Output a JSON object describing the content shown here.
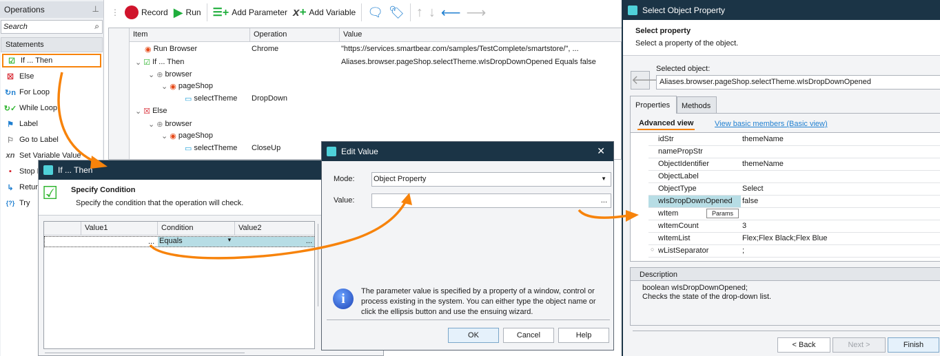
{
  "operations_panel": {
    "title": "Operations",
    "search_placeholder": "Search",
    "section": "Statements",
    "items": [
      "If ... Then",
      "Else",
      "For Loop",
      "While Loop",
      "Label",
      "Go to Label",
      "Set Variable Value",
      "Stop E",
      "Retur",
      "Try"
    ]
  },
  "toolbar": {
    "record": "Record",
    "run": "Run",
    "add_parameter": "Add Parameter",
    "add_variable": "Add Variable"
  },
  "test_grid": {
    "columns": [
      "Item",
      "Operation",
      "Value"
    ],
    "rows": [
      {
        "item": "Run Browser",
        "operation": "Chrome",
        "value": "\"https://services.smartbear.com/samples/TestComplete/smartstore/\", ..."
      },
      {
        "item": "If ... Then",
        "operation": "",
        "value": "Aliases.browser.pageShop.selectTheme.wIsDropDownOpened Equals false"
      },
      {
        "item": "browser",
        "operation": "",
        "value": ""
      },
      {
        "item": "pageShop",
        "operation": "",
        "value": ""
      },
      {
        "item": "selectTheme",
        "operation": "DropDown",
        "value": ""
      },
      {
        "item": "Else",
        "operation": "",
        "value": ""
      },
      {
        "item": "browser",
        "operation": "",
        "value": ""
      },
      {
        "item": "pageShop",
        "operation": "",
        "value": ""
      },
      {
        "item": "selectTheme",
        "operation": "CloseUp",
        "value": ""
      }
    ]
  },
  "if_dialog": {
    "title": "If ... Then",
    "heading": "Specify Condition",
    "subheading": "Specify the condition that the operation will check.",
    "columns": [
      "Value1",
      "Condition",
      "Value2"
    ],
    "condition_value": "Equals",
    "ellipsis": "..."
  },
  "edit_value_dialog": {
    "title": "Edit Value",
    "mode_label": "Mode:",
    "mode_value": "Object Property",
    "value_label": "Value:",
    "value_value": "",
    "ellipsis": "...",
    "info": "The parameter value is specified by a property of a window, control or process existing in the system. You can either type the object name or click the ellipsis button and use the ensuing wizard.",
    "ok": "OK",
    "cancel": "Cancel",
    "help": "Help"
  },
  "select_property_dialog": {
    "title": "Select Object Property",
    "heading": "Select property",
    "subheading": "Select a property of the object.",
    "selected_object_label": "Selected object:",
    "selected_object": "Aliases.browser.pageShop.selectTheme.wIsDropDownOpened",
    "tabs": [
      "Properties",
      "Methods"
    ],
    "advanced_view": "Advanced view",
    "basic_view_link": "View basic members (Basic view)",
    "properties": [
      {
        "name": "idStr",
        "value": "themeName"
      },
      {
        "name": "namePropStr",
        "value": ""
      },
      {
        "name": "ObjectIdentifier",
        "value": "themeName"
      },
      {
        "name": "ObjectLabel",
        "value": ""
      },
      {
        "name": "ObjectType",
        "value": "Select"
      },
      {
        "name": "wIsDropDownOpened",
        "value": "false"
      },
      {
        "name": "wItem",
        "value": "",
        "button": "Params"
      },
      {
        "name": "wItemCount",
        "value": "3"
      },
      {
        "name": "wItemList",
        "value": "Flex;Flex Black;Flex Blue"
      },
      {
        "name": "wListSeparator",
        "value": ";"
      }
    ],
    "description_title": "Description",
    "description_line1": "boolean wIsDropDownOpened;",
    "description_line2": "Checks the state of the drop-down list.",
    "back": "< Back",
    "next": "Next >",
    "finish": "Finish"
  },
  "colors": {
    "accent": "#f7830b",
    "titlebar": "#1b3446",
    "selection": "#b7dde5"
  }
}
